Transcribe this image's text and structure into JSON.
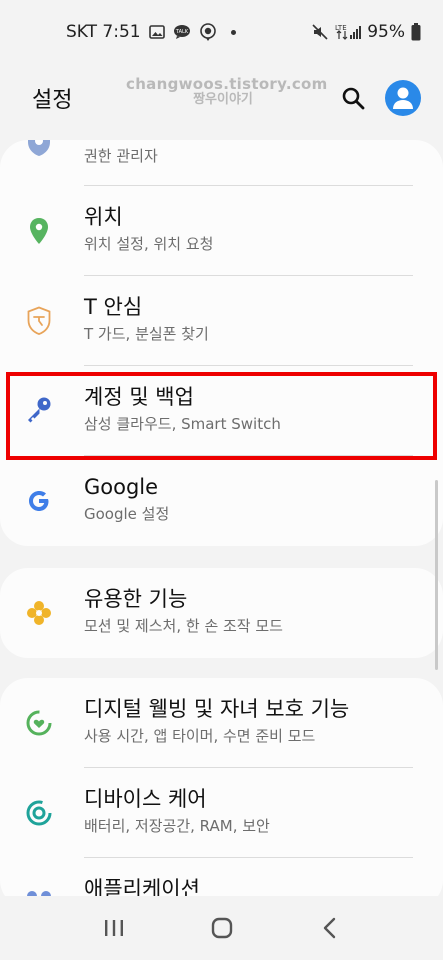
{
  "status": {
    "carrier_time": "SKT 7:51",
    "lte": "LTE",
    "battery": "95%"
  },
  "header": {
    "title": "설정",
    "watermark_line1": "changwoos.tistory.com",
    "watermark_line2": "짱우이야기"
  },
  "items": [
    {
      "title": "",
      "subtitle": "권한 관리자",
      "icon": "shield-icon",
      "color": "#8fa7d6"
    },
    {
      "title": "위치",
      "subtitle": "위치 설정, 위치 요청",
      "icon": "location-pin-icon",
      "color": "#57b460"
    },
    {
      "title": "T 안심",
      "subtitle": "T 가드, 분실폰 찾기",
      "icon": "t-guard-shield-icon",
      "color": "#e8a45a"
    },
    {
      "title": "계정 및 백업",
      "subtitle": "삼성 클라우드, Smart Switch",
      "icon": "key-icon",
      "color": "#3f67c9"
    },
    {
      "title": "Google",
      "subtitle": "Google 설정",
      "icon": "google-icon",
      "color": "#3f7ee8"
    },
    {
      "title": "유용한 기능",
      "subtitle": "모션 및 제스처, 한 손 조작 모드",
      "icon": "puzzle-icon",
      "color": "#f0b429"
    },
    {
      "title": "디지털 웰빙 및 자녀 보호 기능",
      "subtitle": "사용 시간, 앱 타이머, 수면 준비 모드",
      "icon": "wellbeing-icon",
      "color": "#55b25c"
    },
    {
      "title": "디바이스 케어",
      "subtitle": "배터리, 저장공간, RAM, 보안",
      "icon": "device-care-icon",
      "color": "#1fa39a"
    },
    {
      "title": "애플리케이션",
      "subtitle": "",
      "icon": "apps-icon",
      "color": "#6f8fd8"
    }
  ]
}
